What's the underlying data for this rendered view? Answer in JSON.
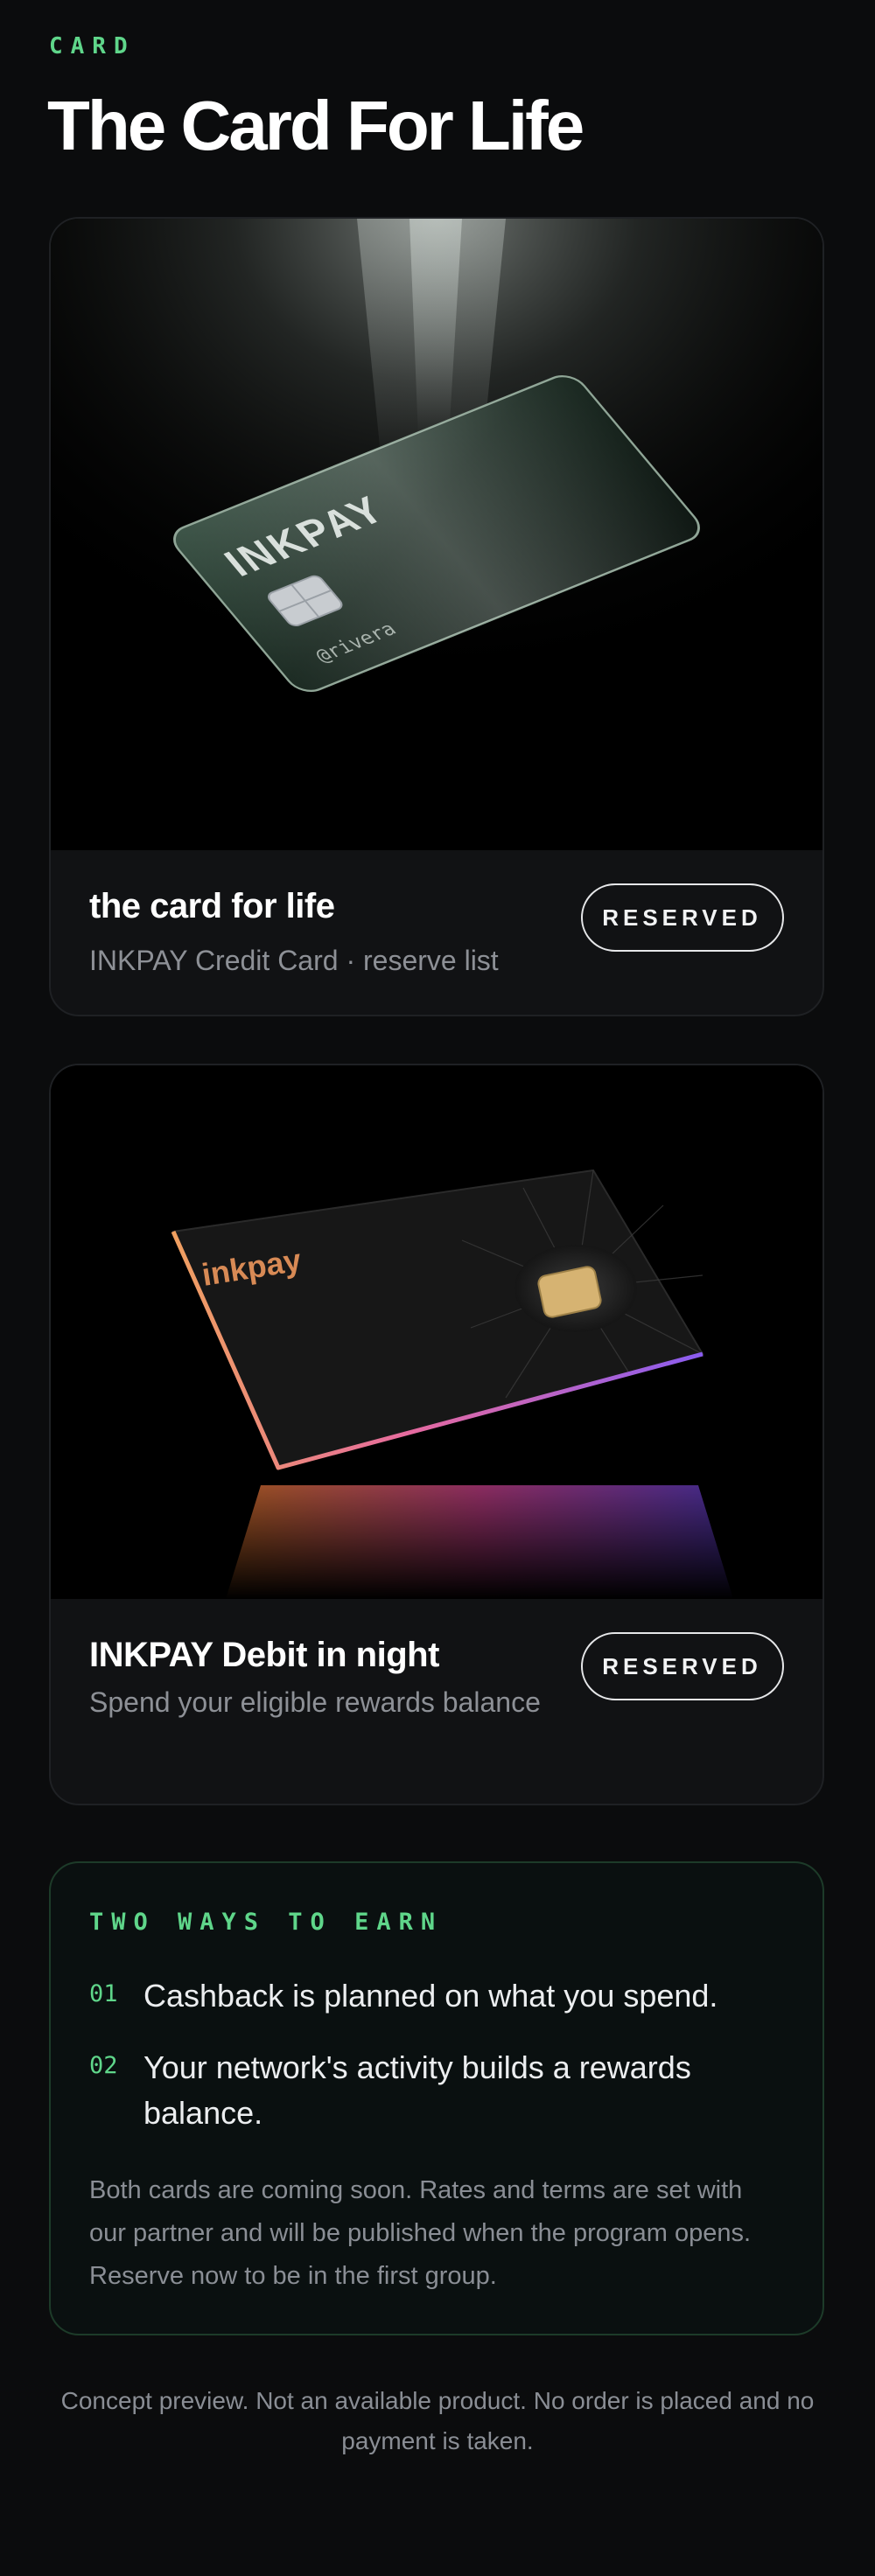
{
  "header": {
    "eyebrow": "CARD",
    "title": "The Card For Life"
  },
  "cards": [
    {
      "title": "the card for life",
      "subtitle": "INKPAY Credit Card · reserve list",
      "button_label": "RESERVED",
      "image": {
        "brand": "INKPAY",
        "handle": "@rivera",
        "color": "#2a3f33"
      }
    },
    {
      "title": "INKPAY Debit in night",
      "subtitle": "Spend your eligible rewards balance",
      "button_label": "RESERVED",
      "image": {
        "brand": "inkpay",
        "color": "#141414"
      }
    }
  ],
  "earn": {
    "title": "TWO WAYS TO EARN",
    "items": [
      {
        "num": "01",
        "text": "Cashback is planned on what you spend."
      },
      {
        "num": "02",
        "text": "Your network's activity builds a rewards balance."
      }
    ],
    "note": "Both cards are coming soon. Rates and terms are set with our partner and will be published when the program opens. Reserve now to be in the first group."
  },
  "footer": {
    "note": "Concept preview. Not an available product. No order is placed and no payment is taken."
  },
  "colors": {
    "accent": "#5fd68a",
    "background": "#0b0c0d",
    "surface": "#111214"
  }
}
